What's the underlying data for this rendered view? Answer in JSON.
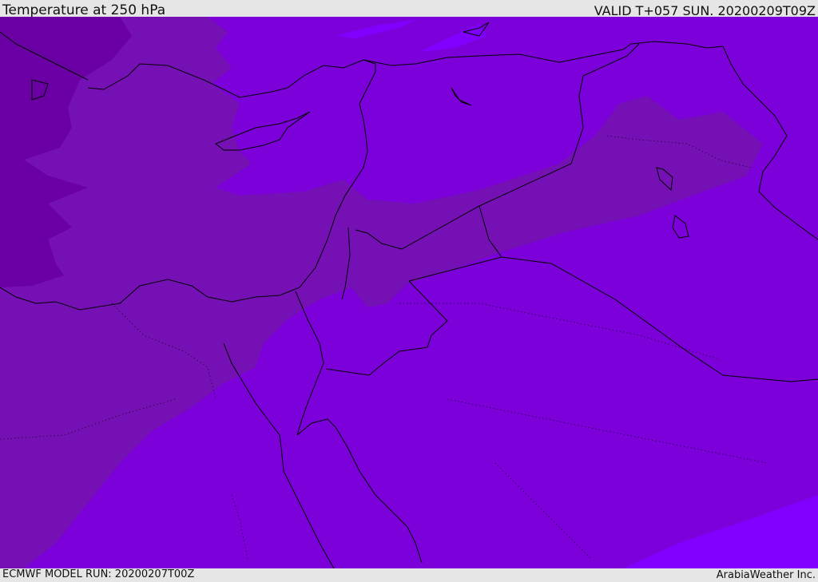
{
  "header": {
    "title": "Temperature at 250 hPa",
    "valid": "VALID T+057 SUN. 20200209T09Z"
  },
  "footer": {
    "model_run": "ECMWF MODEL RUN: 20200207T00Z",
    "credit": "ArabiaWeather Inc."
  },
  "map": {
    "fill_colors": {
      "coldest": "#6a00a3",
      "cold": "#7510b5",
      "base": "#7b00d9",
      "warm": "#7f00ff",
      "coastline": "#000000"
    }
  }
}
